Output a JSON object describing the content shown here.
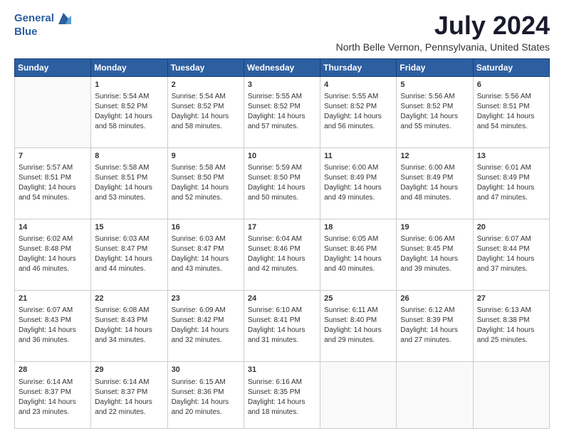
{
  "header": {
    "logo_general": "General",
    "logo_blue": "Blue",
    "main_title": "July 2024",
    "subtitle": "North Belle Vernon, Pennsylvania, United States"
  },
  "days_of_week": [
    "Sunday",
    "Monday",
    "Tuesday",
    "Wednesday",
    "Thursday",
    "Friday",
    "Saturday"
  ],
  "weeks": [
    [
      {
        "day": "",
        "info": ""
      },
      {
        "day": "1",
        "sunrise": "Sunrise: 5:54 AM",
        "sunset": "Sunset: 8:52 PM",
        "daylight": "Daylight: 14 hours and 58 minutes."
      },
      {
        "day": "2",
        "sunrise": "Sunrise: 5:54 AM",
        "sunset": "Sunset: 8:52 PM",
        "daylight": "Daylight: 14 hours and 58 minutes."
      },
      {
        "day": "3",
        "sunrise": "Sunrise: 5:55 AM",
        "sunset": "Sunset: 8:52 PM",
        "daylight": "Daylight: 14 hours and 57 minutes."
      },
      {
        "day": "4",
        "sunrise": "Sunrise: 5:55 AM",
        "sunset": "Sunset: 8:52 PM",
        "daylight": "Daylight: 14 hours and 56 minutes."
      },
      {
        "day": "5",
        "sunrise": "Sunrise: 5:56 AM",
        "sunset": "Sunset: 8:52 PM",
        "daylight": "Daylight: 14 hours and 55 minutes."
      },
      {
        "day": "6",
        "sunrise": "Sunrise: 5:56 AM",
        "sunset": "Sunset: 8:51 PM",
        "daylight": "Daylight: 14 hours and 54 minutes."
      }
    ],
    [
      {
        "day": "7",
        "sunrise": "Sunrise: 5:57 AM",
        "sunset": "Sunset: 8:51 PM",
        "daylight": "Daylight: 14 hours and 54 minutes."
      },
      {
        "day": "8",
        "sunrise": "Sunrise: 5:58 AM",
        "sunset": "Sunset: 8:51 PM",
        "daylight": "Daylight: 14 hours and 53 minutes."
      },
      {
        "day": "9",
        "sunrise": "Sunrise: 5:58 AM",
        "sunset": "Sunset: 8:50 PM",
        "daylight": "Daylight: 14 hours and 52 minutes."
      },
      {
        "day": "10",
        "sunrise": "Sunrise: 5:59 AM",
        "sunset": "Sunset: 8:50 PM",
        "daylight": "Daylight: 14 hours and 50 minutes."
      },
      {
        "day": "11",
        "sunrise": "Sunrise: 6:00 AM",
        "sunset": "Sunset: 8:49 PM",
        "daylight": "Daylight: 14 hours and 49 minutes."
      },
      {
        "day": "12",
        "sunrise": "Sunrise: 6:00 AM",
        "sunset": "Sunset: 8:49 PM",
        "daylight": "Daylight: 14 hours and 48 minutes."
      },
      {
        "day": "13",
        "sunrise": "Sunrise: 6:01 AM",
        "sunset": "Sunset: 8:49 PM",
        "daylight": "Daylight: 14 hours and 47 minutes."
      }
    ],
    [
      {
        "day": "14",
        "sunrise": "Sunrise: 6:02 AM",
        "sunset": "Sunset: 8:48 PM",
        "daylight": "Daylight: 14 hours and 46 minutes."
      },
      {
        "day": "15",
        "sunrise": "Sunrise: 6:03 AM",
        "sunset": "Sunset: 8:47 PM",
        "daylight": "Daylight: 14 hours and 44 minutes."
      },
      {
        "day": "16",
        "sunrise": "Sunrise: 6:03 AM",
        "sunset": "Sunset: 8:47 PM",
        "daylight": "Daylight: 14 hours and 43 minutes."
      },
      {
        "day": "17",
        "sunrise": "Sunrise: 6:04 AM",
        "sunset": "Sunset: 8:46 PM",
        "daylight": "Daylight: 14 hours and 42 minutes."
      },
      {
        "day": "18",
        "sunrise": "Sunrise: 6:05 AM",
        "sunset": "Sunset: 8:46 PM",
        "daylight": "Daylight: 14 hours and 40 minutes."
      },
      {
        "day": "19",
        "sunrise": "Sunrise: 6:06 AM",
        "sunset": "Sunset: 8:45 PM",
        "daylight": "Daylight: 14 hours and 39 minutes."
      },
      {
        "day": "20",
        "sunrise": "Sunrise: 6:07 AM",
        "sunset": "Sunset: 8:44 PM",
        "daylight": "Daylight: 14 hours and 37 minutes."
      }
    ],
    [
      {
        "day": "21",
        "sunrise": "Sunrise: 6:07 AM",
        "sunset": "Sunset: 8:43 PM",
        "daylight": "Daylight: 14 hours and 36 minutes."
      },
      {
        "day": "22",
        "sunrise": "Sunrise: 6:08 AM",
        "sunset": "Sunset: 8:43 PM",
        "daylight": "Daylight: 14 hours and 34 minutes."
      },
      {
        "day": "23",
        "sunrise": "Sunrise: 6:09 AM",
        "sunset": "Sunset: 8:42 PM",
        "daylight": "Daylight: 14 hours and 32 minutes."
      },
      {
        "day": "24",
        "sunrise": "Sunrise: 6:10 AM",
        "sunset": "Sunset: 8:41 PM",
        "daylight": "Daylight: 14 hours and 31 minutes."
      },
      {
        "day": "25",
        "sunrise": "Sunrise: 6:11 AM",
        "sunset": "Sunset: 8:40 PM",
        "daylight": "Daylight: 14 hours and 29 minutes."
      },
      {
        "day": "26",
        "sunrise": "Sunrise: 6:12 AM",
        "sunset": "Sunset: 8:39 PM",
        "daylight": "Daylight: 14 hours and 27 minutes."
      },
      {
        "day": "27",
        "sunrise": "Sunrise: 6:13 AM",
        "sunset": "Sunset: 8:38 PM",
        "daylight": "Daylight: 14 hours and 25 minutes."
      }
    ],
    [
      {
        "day": "28",
        "sunrise": "Sunrise: 6:14 AM",
        "sunset": "Sunset: 8:37 PM",
        "daylight": "Daylight: 14 hours and 23 minutes."
      },
      {
        "day": "29",
        "sunrise": "Sunrise: 6:14 AM",
        "sunset": "Sunset: 8:37 PM",
        "daylight": "Daylight: 14 hours and 22 minutes."
      },
      {
        "day": "30",
        "sunrise": "Sunrise: 6:15 AM",
        "sunset": "Sunset: 8:36 PM",
        "daylight": "Daylight: 14 hours and 20 minutes."
      },
      {
        "day": "31",
        "sunrise": "Sunrise: 6:16 AM",
        "sunset": "Sunset: 8:35 PM",
        "daylight": "Daylight: 14 hours and 18 minutes."
      },
      {
        "day": "",
        "info": ""
      },
      {
        "day": "",
        "info": ""
      },
      {
        "day": "",
        "info": ""
      }
    ]
  ]
}
